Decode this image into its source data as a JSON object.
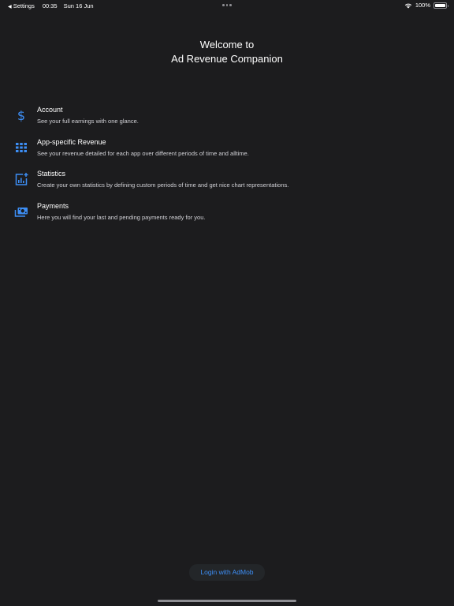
{
  "status_bar": {
    "back_label": "Settings",
    "time": "00:35",
    "date": "Sun 16 Jun",
    "battery": "100%",
    "battery_level": 1.0
  },
  "welcome": {
    "line1": "Welcome to",
    "line2": "Ad Revenue Companion"
  },
  "features": [
    {
      "icon": "dollar-icon",
      "title": "Account",
      "description": "See your full earnings with one glance."
    },
    {
      "icon": "grid-icon",
      "title": "App-specific Revenue",
      "description": "See your revenue detailed for each app over different periods of time and alltime."
    },
    {
      "icon": "chart-add-icon",
      "title": "Statistics",
      "description": "Create your own statistics by defining custom periods of time and get nice chart representations."
    },
    {
      "icon": "payment-icon",
      "title": "Payments",
      "description": "Here you will find your last and pending payments ready for you."
    }
  ],
  "login_button": {
    "label": "Login with AdMob"
  },
  "colors": {
    "background": "#1c1c1e",
    "accent": "#3d8ef5",
    "text_primary": "#ffffff",
    "text_secondary": "#d1d1d6"
  }
}
